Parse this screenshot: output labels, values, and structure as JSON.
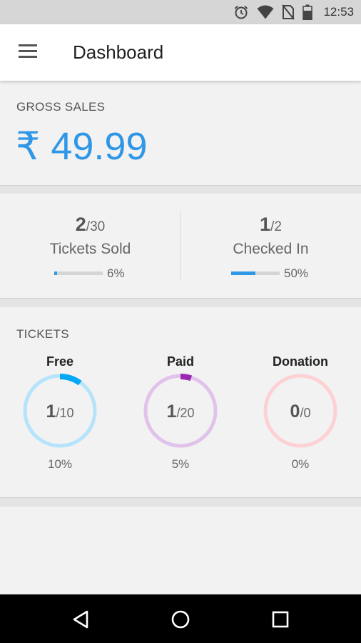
{
  "status_bar": {
    "time": "12:53",
    "icons": [
      "alarm-icon",
      "wifi-icon",
      "no-sim-icon",
      "battery-icon"
    ]
  },
  "app_bar": {
    "menu_icon": "hamburger-menu-icon",
    "title": "Dashboard"
  },
  "gross_sales": {
    "label": "GROSS SALES",
    "value": "₹ 49.99",
    "color": "#2f97e6"
  },
  "stats": [
    {
      "count": "2",
      "total": "/30",
      "label": "Tickets Sold",
      "percent_text": "6%",
      "progress": 0.06
    },
    {
      "count": "1",
      "total": "/2",
      "label": "Checked In",
      "percent_text": "50%",
      "progress": 0.5
    }
  ],
  "tickets": {
    "title": "TICKETS",
    "items": [
      {
        "name": "Free",
        "count": "1",
        "total": "/10",
        "percent_text": "10%",
        "progress": 0.1,
        "track_color": "#b5e3fb",
        "accent_color": "#03a9f4"
      },
      {
        "name": "Paid",
        "count": "1",
        "total": "/20",
        "percent_text": "5%",
        "progress": 0.05,
        "track_color": "#e0c2ea",
        "accent_color": "#9c27b0"
      },
      {
        "name": "Donation",
        "count": "0",
        "total": "/0",
        "percent_text": "0%",
        "progress": 0.0,
        "track_color": "#fdd1d4",
        "accent_color": "#f44336"
      }
    ]
  },
  "nav_bar": {
    "icons": [
      "back-icon",
      "home-icon",
      "recents-icon"
    ]
  }
}
